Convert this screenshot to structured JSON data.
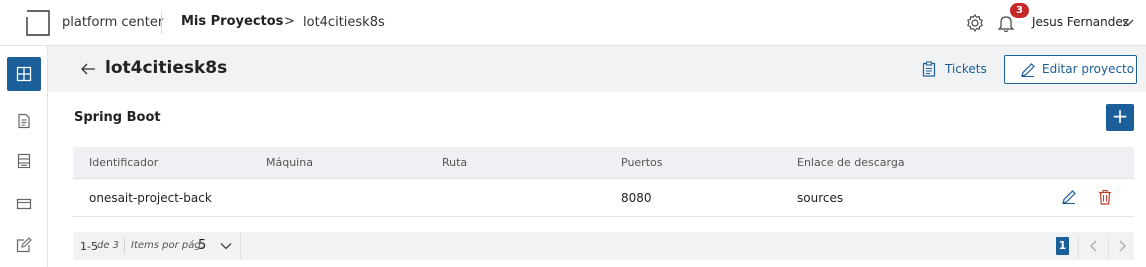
{
  "header": {
    "brand": "platform center",
    "breadcrumb_main": "Mis Proyectos",
    "breadcrumb_sep": ">",
    "breadcrumb_current": "lot4citiesk8s",
    "notifications_count": "3",
    "user_name": "Jesus Fernandez",
    "icons": [
      "logo-icon",
      "gear-icon",
      "bell-icon",
      "chevron-down-icon"
    ]
  },
  "sidebar": {
    "items": [
      {
        "icon": "grid-icon",
        "active": true
      },
      {
        "icon": "document-icon",
        "active": false
      },
      {
        "icon": "server-icon",
        "active": false
      },
      {
        "icon": "card-icon",
        "active": false
      },
      {
        "icon": "edit-square-icon",
        "active": false
      }
    ]
  },
  "page": {
    "title": "lot4citiesk8s",
    "tickets_label": "Tickets",
    "edit_label": "Editar proyecto"
  },
  "section": {
    "title": "Spring Boot",
    "add_label": "+"
  },
  "table": {
    "columns": [
      "Identificador",
      "Máquina",
      "Ruta",
      "Puertos",
      "Enlace de descarga"
    ],
    "rows": [
      [
        "onesait-project-back",
        "",
        "",
        "8080",
        "sources"
      ]
    ]
  },
  "pagination": {
    "range": "1-5",
    "of_total": "de 3",
    "items_per_page_label": "Items por pág.",
    "items_per_page": "5",
    "current_page": "1"
  },
  "colors": {
    "accent": "#1a5e9a",
    "badge": "#c62828",
    "trash": "#c0392b"
  }
}
